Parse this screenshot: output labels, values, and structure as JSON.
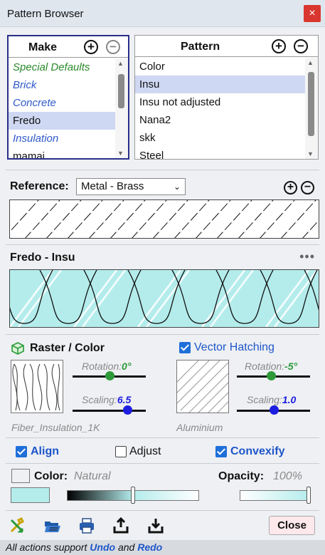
{
  "window": {
    "title": "Pattern Browser",
    "close_glyph": "×"
  },
  "make": {
    "header": "Make",
    "items": [
      {
        "label": "Special Defaults",
        "style": "green"
      },
      {
        "label": "Brick",
        "style": "italic-blue"
      },
      {
        "label": "Concrete",
        "style": "italic-blue"
      },
      {
        "label": "Fredo",
        "style": "selected"
      },
      {
        "label": "Insulation",
        "style": "italic-blue"
      },
      {
        "label": "mamai",
        "style": "normal"
      }
    ]
  },
  "pattern": {
    "header": "Pattern",
    "items": [
      {
        "label": "Color",
        "style": "normal"
      },
      {
        "label": "Insu",
        "style": "selected"
      },
      {
        "label": "Insu not adjusted",
        "style": "normal"
      },
      {
        "label": "Nana2",
        "style": "normal"
      },
      {
        "label": "skk",
        "style": "normal"
      },
      {
        "label": "Steel",
        "style": "normal"
      }
    ]
  },
  "reference": {
    "label": "Reference:",
    "selected": "Metal - Brass"
  },
  "current_pattern": {
    "name": "Fredo - Insu",
    "more": "•••",
    "fill_color": "#b4ecec"
  },
  "raster": {
    "title": "Raster / Color",
    "rotation_label": "Rotation:",
    "rotation_value": "0°",
    "rotation_fraction": 0.5,
    "scaling_label": "Scaling:",
    "scaling_value": "6.5",
    "scaling_fraction": 0.75,
    "caption": "Fiber_Insulation_1K",
    "knob_colors": {
      "rotation": "#2f9a3a",
      "scaling": "#1d1ee0"
    }
  },
  "vector": {
    "title": "Vector Hatching",
    "checked": true,
    "rotation_label": "Rotation:",
    "rotation_value": "-5°",
    "rotation_fraction": 0.47,
    "scaling_label": "Scaling:",
    "scaling_value": "1.0",
    "scaling_fraction": 0.5,
    "caption": "Aluminium"
  },
  "options": {
    "align": {
      "label": "Align",
      "checked": true
    },
    "adjust": {
      "label": "Adjust",
      "checked": false
    },
    "convexify": {
      "label": "Convexify",
      "checked": true
    }
  },
  "color": {
    "label": "Color:",
    "value": "Natural",
    "preview": "#b4ecec",
    "slider_fraction": 0.5
  },
  "opacity": {
    "label": "Opacity:",
    "value": "100%",
    "fraction": 1.0
  },
  "toolbar": {
    "icons": [
      "tools-icon",
      "open-folder-icon",
      "print-icon",
      "export-icon",
      "import-icon"
    ],
    "close_label": "Close"
  },
  "status": {
    "prefix": "All actions support ",
    "undo": "Undo",
    "middle": " and ",
    "redo": "Redo"
  },
  "colors": {
    "accent": "#1e56c9",
    "selected_row": "#cfd8f2",
    "title_bar": "#dfe6ee"
  }
}
